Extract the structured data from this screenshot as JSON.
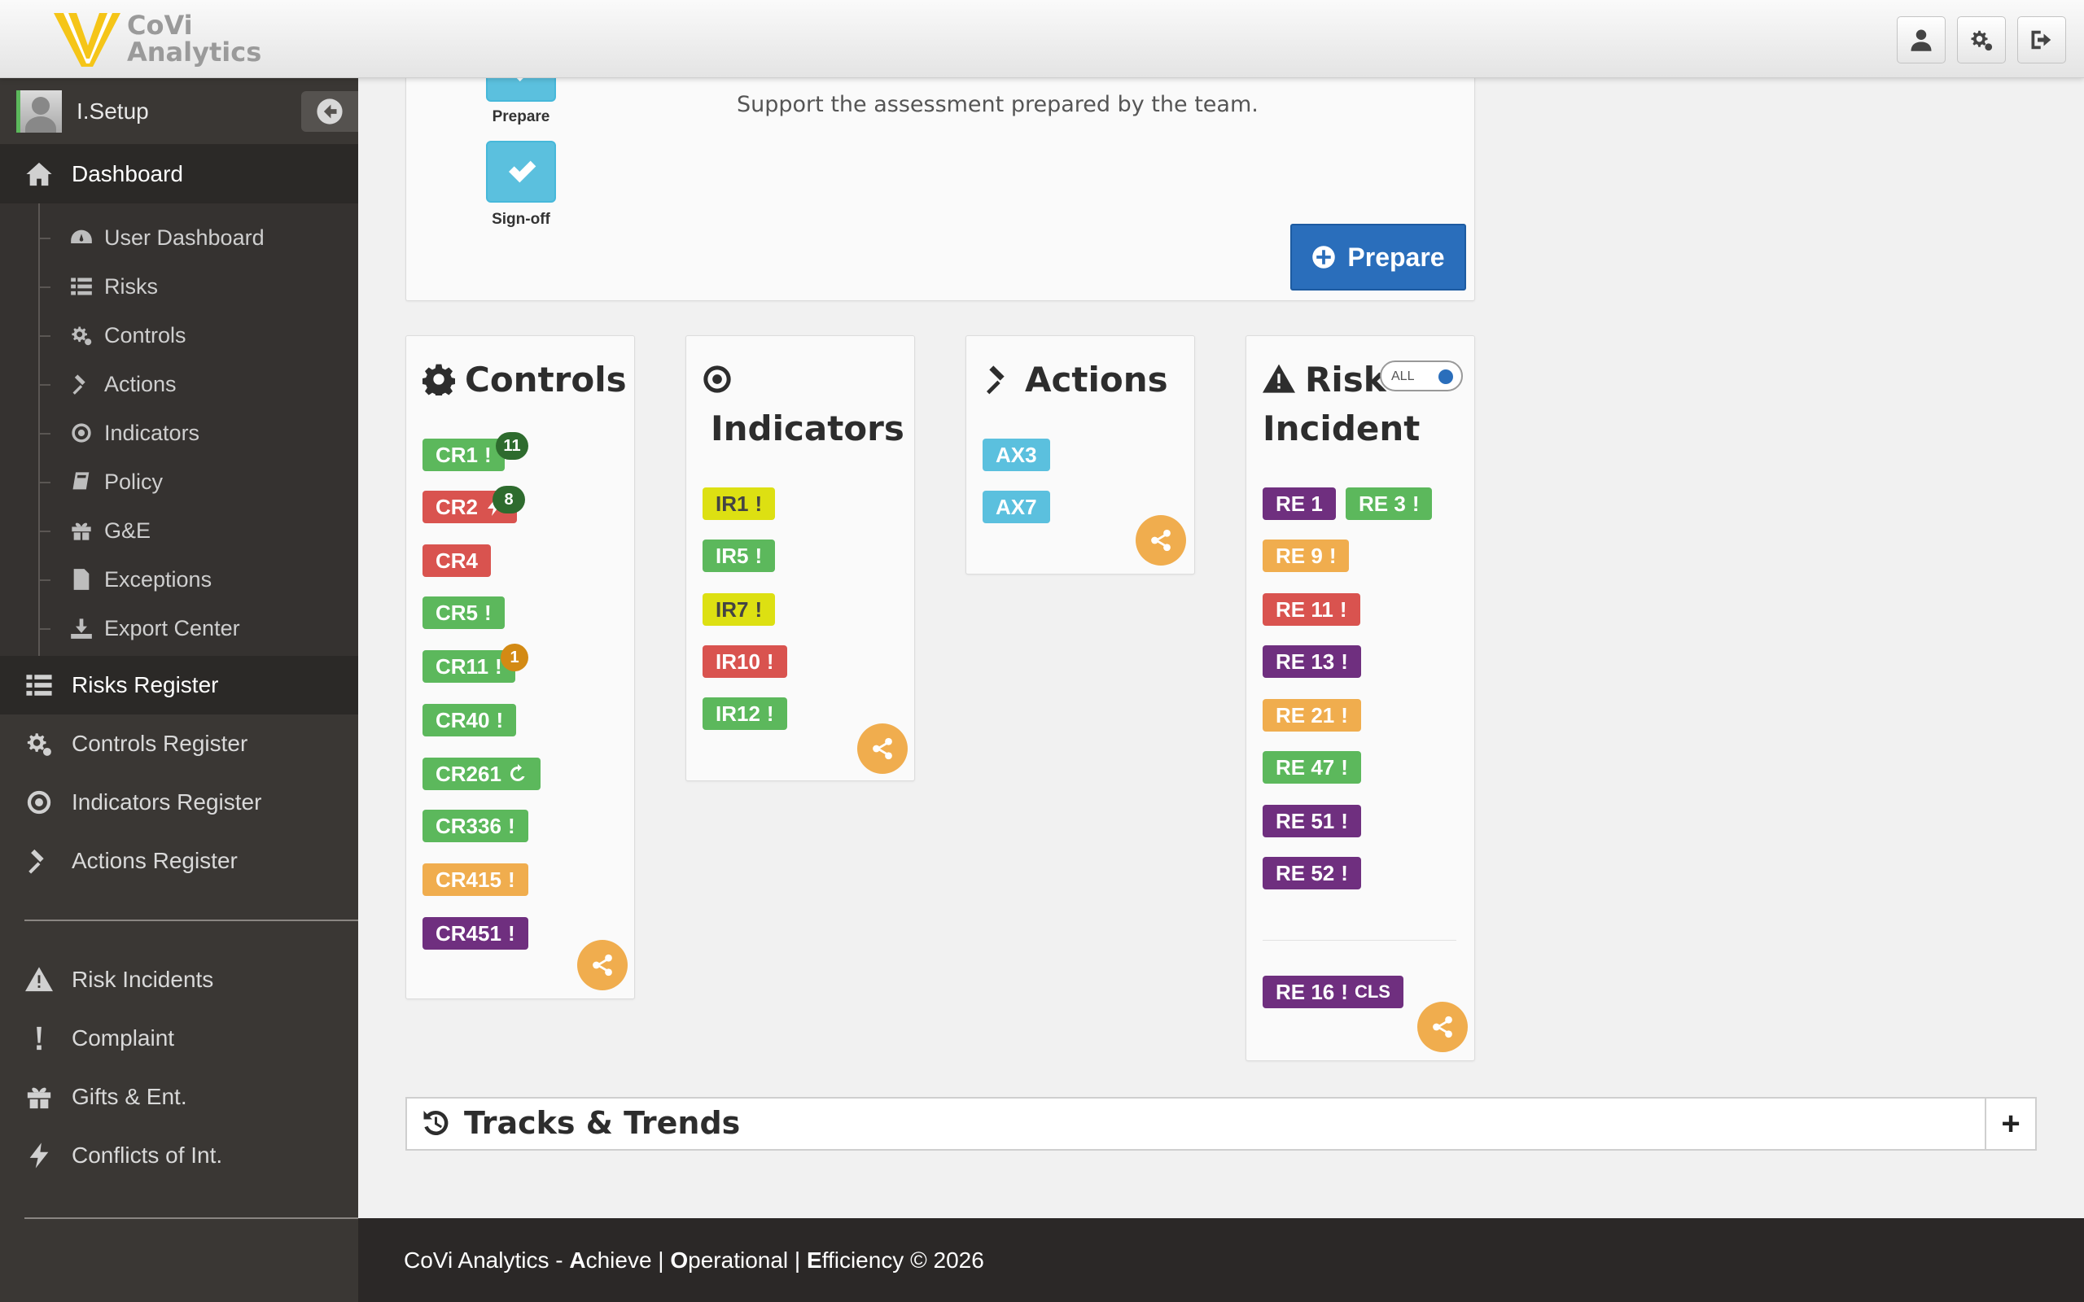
{
  "brand": {
    "line1": "CoVi",
    "line2": "Analytics",
    "accent": "#f5c518"
  },
  "topbar": {
    "buttons": [
      {
        "icon": "user-icon"
      },
      {
        "icon": "gears-icon"
      },
      {
        "icon": "sign-out-icon"
      }
    ]
  },
  "sidebar": {
    "user": "I.Setup",
    "dashboard": {
      "label": "Dashboard",
      "items": [
        {
          "label": "User Dashboard",
          "icon": "dashboard-icon"
        },
        {
          "label": "Risks",
          "icon": "list-icon"
        },
        {
          "label": "Controls",
          "icon": "gears-icon"
        },
        {
          "label": "Actions",
          "icon": "gavel-icon"
        },
        {
          "label": "Indicators",
          "icon": "target-icon"
        },
        {
          "label": "Policy",
          "icon": "book-icon"
        },
        {
          "label": "G&E",
          "icon": "gift-icon"
        },
        {
          "label": "Exceptions",
          "icon": "file-icon"
        },
        {
          "label": "Export Center",
          "icon": "download-icon"
        }
      ]
    },
    "registers": [
      {
        "label": "Risks Register",
        "icon": "list-icon"
      },
      {
        "label": "Controls Register",
        "icon": "gears-icon"
      },
      {
        "label": "Indicators Register",
        "icon": "target-icon"
      },
      {
        "label": "Actions Register",
        "icon": "gavel-icon"
      }
    ],
    "incidents": [
      {
        "label": "Risk Incidents",
        "icon": "warning-icon"
      },
      {
        "label": "Complaint",
        "icon": "exclamation-icon"
      },
      {
        "label": "Gifts & Ent.",
        "icon": "gift-icon"
      },
      {
        "label": "Conflicts of Int.",
        "icon": "bolt-icon"
      }
    ]
  },
  "workflow": {
    "steps": [
      {
        "label": "Prepare"
      },
      {
        "label": "Sign-off"
      }
    ],
    "support_text": "Support the assessment prepared by the team.",
    "prepare_button": "Prepare"
  },
  "cards": {
    "controls": {
      "title": "Controls",
      "tags": [
        {
          "code": "CR1",
          "color": "green",
          "mark": "!",
          "badge": "11"
        },
        {
          "code": "CR2",
          "color": "red",
          "mark": "bolt",
          "badge": "8"
        },
        {
          "code": "CR4",
          "color": "red",
          "mark": ""
        },
        {
          "code": "CR5",
          "color": "green",
          "mark": "!"
        },
        {
          "code": "CR11",
          "color": "green",
          "mark": "!",
          "badge": "1"
        },
        {
          "code": "CR40",
          "color": "green",
          "mark": "!"
        },
        {
          "code": "CR261",
          "color": "green",
          "mark": "refresh"
        },
        {
          "code": "CR336",
          "color": "green",
          "mark": "!"
        },
        {
          "code": "CR415",
          "color": "orange",
          "mark": "!"
        },
        {
          "code": "CR451",
          "color": "purple",
          "mark": "!"
        }
      ]
    },
    "indicators": {
      "title": "Indicators",
      "tags": [
        {
          "code": "IR1",
          "color": "yellow",
          "mark": "!"
        },
        {
          "code": "IR5",
          "color": "green",
          "mark": "!"
        },
        {
          "code": "IR7",
          "color": "yellow",
          "mark": "!"
        },
        {
          "code": "IR10",
          "color": "red",
          "mark": "!"
        },
        {
          "code": "IR12",
          "color": "green",
          "mark": "!"
        }
      ]
    },
    "actions": {
      "title": "Actions",
      "tags": [
        {
          "code": "AX3",
          "color": "blue"
        },
        {
          "code": "AX7",
          "color": "blue"
        }
      ]
    },
    "risk_incident": {
      "title_line1": "Risk",
      "title_line2": "Incident",
      "toggle_label": "ALL",
      "tags": [
        {
          "code": "RE 1",
          "color": "purple",
          "mark": ""
        },
        {
          "code": "RE 3",
          "color": "green",
          "mark": "!"
        },
        {
          "code": "RE 9",
          "color": "orange",
          "mark": "!"
        },
        {
          "code": "RE 11",
          "color": "red",
          "mark": "!"
        },
        {
          "code": "RE 13",
          "color": "purple",
          "mark": "!"
        },
        {
          "code": "RE 21",
          "color": "orange",
          "mark": "!"
        },
        {
          "code": "RE 47",
          "color": "green",
          "mark": "!"
        },
        {
          "code": "RE 51",
          "color": "purple",
          "mark": "!"
        },
        {
          "code": "RE 52",
          "color": "purple",
          "mark": "!"
        }
      ],
      "closed": [
        {
          "code": "RE 16",
          "color": "purple",
          "mark": "!",
          "suffix": "CLS"
        }
      ]
    }
  },
  "tracks": {
    "title": "Tracks & Trends",
    "expand": "+"
  },
  "footer": {
    "brand": "CoVi Analytics",
    "sep": " - ",
    "a": "A",
    "a_rest": "chieve",
    "o": "O",
    "o_rest": "perational",
    "e": "E",
    "e_rest": "fficiency",
    "copy": "© 2026"
  },
  "colors": {
    "green": "#5cb85c",
    "red": "#d9534f",
    "orange": "#f0ad4e",
    "purple": "#6f2f7f",
    "yellow": "#dde012",
    "blue": "#5bc0de",
    "primary": "#2a6ebb",
    "sidebar": "#3a3734"
  }
}
